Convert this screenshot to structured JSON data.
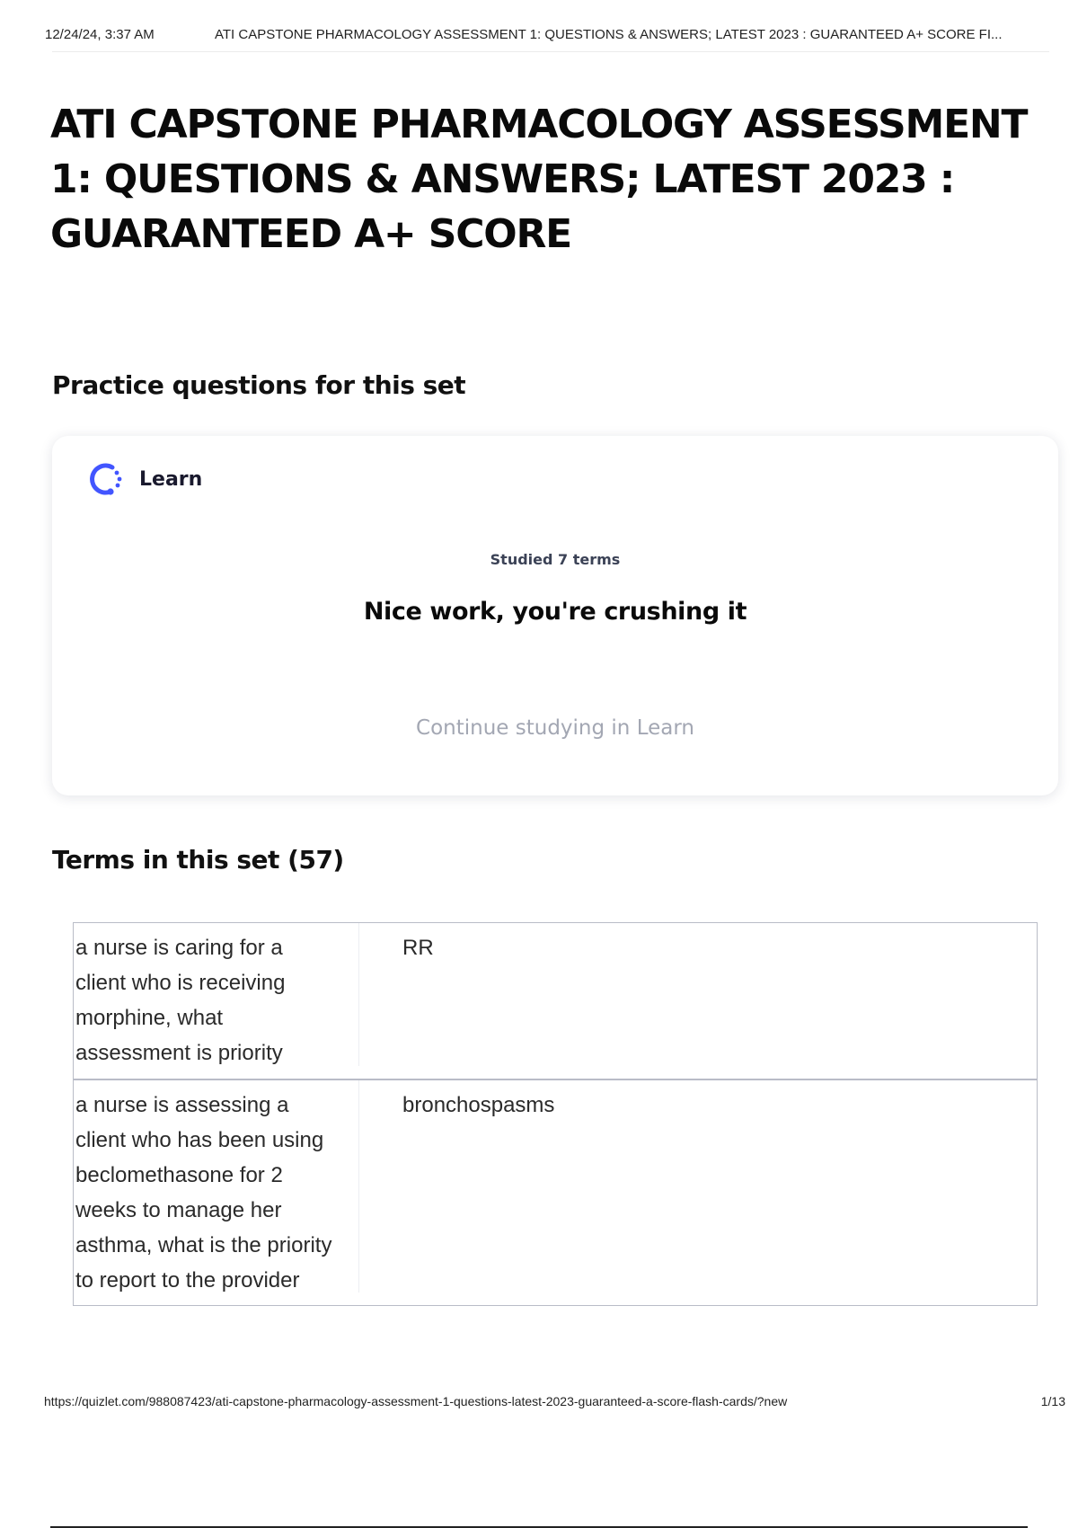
{
  "print_header": {
    "date": "12/24/24, 3:37 AM",
    "title": "ATI CAPSTONE PHARMACOLOGY ASSESSMENT 1: QUESTIONS & ANSWERS; LATEST 2023 : GUARANTEED A+ SCORE FI..."
  },
  "page": {
    "title": "ATI CAPSTONE PHARMACOLOGY ASSESSMENT 1: QUESTIONS & ANSWERS; LATEST 2023 : GUARANTEED A+ SCORE"
  },
  "practice": {
    "heading": "Practice questions for this set",
    "learn_card": {
      "icon": "learn-progress-icon",
      "label": "Learn",
      "studied": "Studied 7 terms",
      "message": "Nice work, you're crushing it",
      "continue": "Continue studying in Learn"
    }
  },
  "terms": {
    "heading": "Terms in this set (57)",
    "rows": [
      {
        "term_lines": [
          "a nurse is caring for a",
          "client who is receiving",
          "morphine, what",
          "assessment is priority"
        ],
        "definition": "RR"
      },
      {
        "term_lines": [
          "a nurse is assessing a",
          "client who has been using",
          "beclomethasone for 2",
          "weeks to manage her",
          "asthma, what is the priority",
          "to report to the provider"
        ],
        "definition": "bronchospasms"
      }
    ]
  },
  "print_footer": {
    "url": "https://quizlet.com/988087423/ati-capstone-pharmacology-assessment-1-questions-latest-2023-guaranteed-a-score-flash-cards/?new",
    "page": "1/13"
  },
  "colors": {
    "learn_icon": "#4255ff",
    "continue_text": "#a3a7b3",
    "table_border": "#b9bcc7"
  }
}
